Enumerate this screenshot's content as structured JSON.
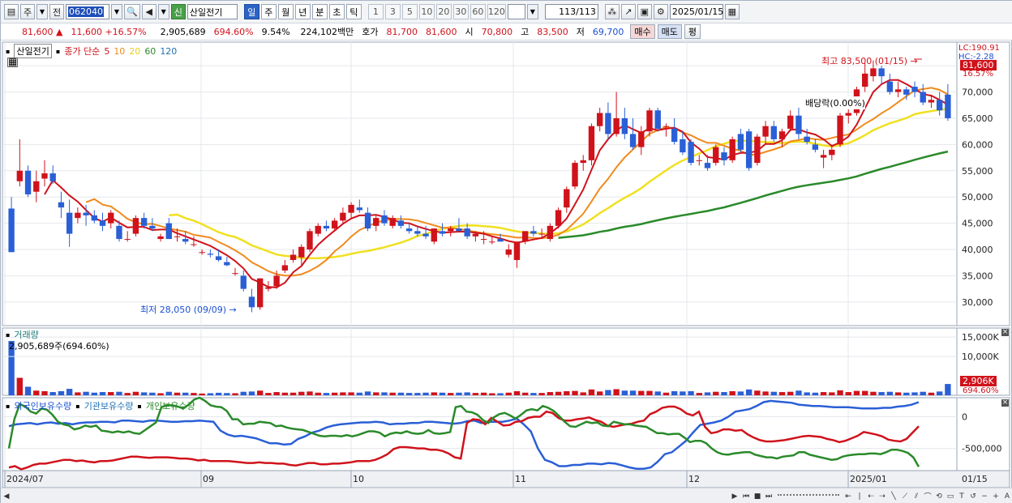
{
  "toolbar": {
    "market_kind": "주",
    "prev_label": "전",
    "code": "062040",
    "badge": "신",
    "stock_name": "산일전기",
    "periods": [
      "일",
      "주",
      "월",
      "년",
      "분",
      "초",
      "틱"
    ],
    "active_period": "일",
    "intervals": [
      "1",
      "3",
      "5",
      "10",
      "20",
      "30",
      "60",
      "120"
    ],
    "count": "113",
    "total": "113",
    "date": "2025/01/15"
  },
  "info": {
    "price": "81,600",
    "arrow": "▲",
    "change": "11,600",
    "change_pct": "+16.57%",
    "volume": "2,905,689",
    "volume_pct": "694.60%",
    "turnover": "9.54%",
    "amount": "224,102백만",
    "quote_label": "호가",
    "ask": "81,700",
    "bid": "81,600",
    "open_label": "시",
    "open": "70,800",
    "high_label": "고",
    "high": "83,500",
    "low_label": "저",
    "low": "69,700",
    "buy": "매수",
    "sell": "매도",
    "eval": "평"
  },
  "price_panel": {
    "legend_name": "산일전기",
    "legend_type": "종가 단순",
    "ma_labels": [
      "5",
      "10",
      "20",
      "60",
      "120"
    ],
    "lc": "LC:190.91",
    "hc": "HC:-2.28",
    "current_tag": "81,600",
    "current_pct": "16.57%",
    "high_note": "최고 83,500 (01/15)",
    "low_note": "최저 28,050 (09/09)",
    "dividend_note": "배당락(0.00%)",
    "y_ticks": [
      "75,000",
      "70,000",
      "65,000",
      "60,000",
      "55,000",
      "50,000",
      "45,000",
      "40,000",
      "35,000",
      "30,000"
    ]
  },
  "volume_panel": {
    "title": "거래량",
    "value": "2,905,689주(694.60%)",
    "y_ticks": [
      "15,000K",
      "10,000K"
    ],
    "current_tag": "2,906K",
    "current_pct": "694.60%"
  },
  "holdings_panel": {
    "series": [
      "외국인보유수량",
      "기관보유수량",
      "개인보유수량"
    ],
    "y_ticks": [
      "0",
      "-500,000"
    ]
  },
  "x_axis": {
    "labels": [
      "2024/07",
      "09",
      "10",
      "11",
      "12",
      "2025/01"
    ],
    "right_label": "01/15"
  },
  "colors": {
    "up": "#d0121b",
    "down": "#2a5fd6",
    "ma5": "#d0121b",
    "ma10": "#f08a1c",
    "ma20": "#f0e020",
    "ma60": "#2a8a2a",
    "foreign": "#2a5fd6",
    "institution": "#d0121b",
    "individual": "#2a8a2a"
  },
  "chart_data": {
    "type": "candlestick",
    "candles": [
      [
        47800,
        50000,
        39500,
        39500
      ],
      [
        53000,
        61000,
        52000,
        55000
      ],
      [
        55000,
        56000,
        50000,
        50500
      ],
      [
        51000,
        55000,
        49000,
        53000
      ],
      [
        53500,
        57000,
        52000,
        54500
      ],
      [
        54500,
        56000,
        52500,
        53000
      ],
      [
        49000,
        51000,
        46000,
        48000
      ],
      [
        47000,
        49500,
        40500,
        43000
      ],
      [
        46000,
        48000,
        45000,
        47000
      ],
      [
        47000,
        48500,
        44500,
        46500
      ],
      [
        46500,
        47500,
        45000,
        45500
      ],
      [
        45500,
        47000,
        43500,
        44500
      ],
      [
        45000,
        47500,
        44000,
        47000
      ],
      [
        44500,
        45500,
        41500,
        42000
      ],
      [
        42000,
        43500,
        41500,
        42000
      ],
      [
        43000,
        46500,
        42500,
        46000
      ],
      [
        46000,
        47000,
        44000,
        44500
      ],
      [
        44500,
        46000,
        43500,
        44000
      ],
      [
        42000,
        43000,
        41500,
        42500
      ],
      [
        45000,
        46000,
        42000,
        42000
      ],
      [
        42500,
        44000,
        41500,
        42500
      ],
      [
        42000,
        43500,
        41000,
        41500
      ],
      [
        41000,
        42500,
        40500,
        41000
      ],
      [
        39500,
        40000,
        39000,
        39500
      ],
      [
        39200,
        40000,
        38500,
        39000
      ],
      [
        38700,
        40000,
        37700,
        38000
      ],
      [
        37600,
        38600,
        36800,
        37000
      ],
      [
        35500,
        36500,
        35000,
        35500
      ],
      [
        35000,
        36000,
        32000,
        32500
      ],
      [
        31000,
        32500,
        28050,
        29000
      ],
      [
        29000,
        34500,
        28500,
        34500
      ],
      [
        32500,
        34000,
        32000,
        32800
      ],
      [
        33000,
        36000,
        32500,
        35000
      ],
      [
        36000,
        38000,
        35500,
        37000
      ],
      [
        38000,
        40000,
        37500,
        39000
      ],
      [
        38500,
        41000,
        37000,
        40500
      ],
      [
        40000,
        44000,
        39500,
        43500
      ],
      [
        43000,
        45000,
        42500,
        44500
      ],
      [
        44500,
        45500,
        43500,
        44000
      ],
      [
        44000,
        46000,
        43500,
        45500
      ],
      [
        45500,
        48000,
        45000,
        47000
      ],
      [
        47000,
        49000,
        46000,
        48500
      ],
      [
        48000,
        49500,
        47000,
        47500
      ],
      [
        47000,
        48000,
        43500,
        44000
      ],
      [
        44500,
        46500,
        43500,
        46000
      ],
      [
        46500,
        47500,
        44500,
        45000
      ],
      [
        44500,
        46500,
        44000,
        46000
      ],
      [
        45500,
        46500,
        44000,
        44500
      ],
      [
        44000,
        45000,
        43000,
        43500
      ],
      [
        43500,
        44500,
        42500,
        43000
      ],
      [
        43000,
        44500,
        42000,
        42500
      ],
      [
        41500,
        44000,
        41000,
        44000
      ],
      [
        43500,
        45000,
        42500,
        43000
      ],
      [
        43500,
        44500,
        42500,
        44000
      ],
      [
        44000,
        46000,
        43500,
        43500
      ],
      [
        44000,
        45000,
        42000,
        42500
      ],
      [
        42500,
        43500,
        41500,
        43000
      ],
      [
        42000,
        43500,
        41000,
        42000
      ],
      [
        41500,
        42500,
        41000,
        41500
      ],
      [
        42000,
        43000,
        41500,
        41500
      ],
      [
        39000,
        41000,
        38500,
        40000
      ],
      [
        38000,
        41500,
        36500,
        41500
      ],
      [
        41500,
        43500,
        41000,
        43500
      ],
      [
        43500,
        44500,
        42500,
        43000
      ],
      [
        43000,
        44000,
        42000,
        43000
      ],
      [
        42000,
        45000,
        41500,
        44500
      ],
      [
        44500,
        48000,
        44000,
        47500
      ],
      [
        48000,
        52000,
        47000,
        51500
      ],
      [
        52000,
        57000,
        51500,
        56500
      ],
      [
        56500,
        58000,
        55000,
        57000
      ],
      [
        57000,
        64000,
        56000,
        63500
      ],
      [
        63500,
        67000,
        62500,
        66000
      ],
      [
        66000,
        68000,
        61000,
        62000
      ],
      [
        62000,
        70000,
        61500,
        65000
      ],
      [
        65000,
        67000,
        61000,
        62000
      ],
      [
        62000,
        65000,
        59000,
        59500
      ],
      [
        59500,
        63500,
        58000,
        62500
      ],
      [
        62500,
        67000,
        61500,
        66500
      ],
      [
        66500,
        67000,
        62500,
        63000
      ],
      [
        63500,
        64000,
        61500,
        63500
      ],
      [
        63000,
        65000,
        60000,
        60500
      ],
      [
        61000,
        62500,
        58000,
        58500
      ],
      [
        60500,
        61000,
        56000,
        56500
      ],
      [
        57000,
        58000,
        56000,
        57000
      ],
      [
        56500,
        58000,
        55000,
        55500
      ],
      [
        56500,
        60000,
        56000,
        59500
      ],
      [
        58500,
        59500,
        56000,
        57000
      ],
      [
        57000,
        61500,
        56500,
        61000
      ],
      [
        62000,
        63000,
        58500,
        59000
      ],
      [
        62500,
        63000,
        55000,
        55500
      ],
      [
        56500,
        62000,
        56000,
        61500
      ],
      [
        61500,
        64500,
        60000,
        63500
      ],
      [
        63500,
        64500,
        60500,
        61000
      ],
      [
        61000,
        63000,
        59500,
        62500
      ],
      [
        63000,
        66500,
        62500,
        65500
      ],
      [
        65500,
        67000,
        61000,
        62000
      ],
      [
        61500,
        63000,
        60000,
        60500
      ],
      [
        60000,
        61000,
        58500,
        59000
      ],
      [
        57500,
        59000,
        55500,
        58000
      ],
      [
        58000,
        60000,
        57000,
        59000
      ],
      [
        60000,
        66000,
        59500,
        65500
      ],
      [
        65500,
        67500,
        64000,
        66000
      ],
      [
        66000,
        71000,
        65500,
        70500
      ],
      [
        71000,
        75500,
        70000,
        73500
      ],
      [
        73000,
        76000,
        72000,
        74500
      ],
      [
        74500,
        75000,
        71500,
        73000
      ],
      [
        72000,
        73500,
        69500,
        70000
      ],
      [
        70000,
        72000,
        69000,
        70500
      ],
      [
        70500,
        71000,
        68500,
        69500
      ],
      [
        71000,
        72000,
        69000,
        70000
      ],
      [
        70000,
        71500,
        67500,
        68000
      ],
      [
        68000,
        69500,
        67000,
        68500
      ],
      [
        68500,
        70000,
        65500,
        66500
      ],
      [
        69500,
        71500,
        64500,
        65000
      ]
    ],
    "ma_note": "5/10/20/60 day simple moving averages of close",
    "volume_note": "relative daily volume",
    "y_range": [
      25500,
      79500
    ],
    "volume_max": 16500,
    "holdings_y_range": [
      -850000,
      300000
    ],
    "series": [
      {
        "name": "외국인보유수량",
        "values": [
          -150000,
          -120000,
          -110000,
          -100000,
          -120000,
          -100000,
          -90000,
          -110000,
          -100000,
          -120000,
          -100000,
          -90000,
          -90000,
          -80000,
          -80000,
          -90000,
          -60000,
          -60000,
          -70000,
          -80000,
          -60000,
          -60000,
          -70000,
          -80000,
          -80000,
          -70000,
          -70000,
          -60000,
          -70000,
          -80000,
          -220000,
          -280000,
          -310000,
          -300000,
          -320000,
          -340000,
          -380000,
          -420000,
          -420000,
          -440000,
          -430000,
          -350000,
          -310000,
          -250000,
          -220000,
          -170000,
          -140000,
          -120000,
          -110000,
          -100000,
          -90000,
          -90000,
          -80000,
          -90000,
          -120000,
          -110000,
          -110000,
          -100000,
          -100000,
          -80000,
          -80000,
          -90000,
          -100000,
          -110000,
          -100000,
          -70000,
          -60000,
          -100000,
          -80000,
          -80000,
          -80000,
          -60000,
          -30000,
          -120000,
          -230000,
          -500000,
          -680000,
          -720000,
          -780000,
          -780000,
          -760000,
          -760000,
          -740000,
          -740000,
          -750000,
          -730000,
          -740000,
          -770000,
          -800000,
          -820000,
          -820000,
          -800000,
          -710000,
          -590000,
          -560000,
          -470000,
          -380000,
          -250000,
          -130000,
          -110000,
          -90000,
          -60000,
          0,
          80000,
          100000,
          120000,
          170000,
          230000,
          250000,
          240000,
          230000,
          220000,
          190000,
          180000,
          170000,
          170000,
          160000,
          150000,
          150000,
          150000,
          140000,
          130000,
          130000,
          130000,
          140000,
          140000,
          160000,
          170000,
          190000,
          230000
        ]
      },
      {
        "name": "기관보유수량",
        "values": [
          -800000,
          -780000,
          -830000,
          -800000,
          -760000,
          -740000,
          -740000,
          -720000,
          -700000,
          -680000,
          -680000,
          -700000,
          -690000,
          -710000,
          -720000,
          -700000,
          -700000,
          -690000,
          -670000,
          -650000,
          -630000,
          -630000,
          -640000,
          -650000,
          -640000,
          -640000,
          -640000,
          -650000,
          -660000,
          -660000,
          -670000,
          -690000,
          -680000,
          -700000,
          -700000,
          -700000,
          -700000,
          -710000,
          -720000,
          -730000,
          -730000,
          -720000,
          -730000,
          -730000,
          -740000,
          -740000,
          -760000,
          -770000,
          -750000,
          -730000,
          -730000,
          -750000,
          -750000,
          -740000,
          -740000,
          -730000,
          -720000,
          -700000,
          -700000,
          -700000,
          -680000,
          -640000,
          -590000,
          -510000,
          -480000,
          -480000,
          -490000,
          -500000,
          -500000,
          -520000,
          -520000,
          -540000,
          -580000,
          -640000,
          -660000,
          -100000,
          -40000,
          -50000,
          -120000,
          -20000,
          -80000,
          -140000,
          -130000,
          -80000,
          -70000,
          -20000,
          0,
          0,
          80000,
          60000,
          -20000,
          -60000,
          -60000,
          -40000,
          -30000,
          -10000,
          -50000,
          -80000,
          -140000,
          -160000,
          -140000,
          -120000,
          -110000,
          -80000,
          -60000,
          40000,
          80000,
          140000,
          160000,
          160000,
          120000,
          50000,
          20000,
          80000,
          -160000,
          -260000,
          -240000,
          -200000,
          -200000,
          -220000,
          -210000,
          -280000,
          -330000,
          -370000,
          -390000,
          -390000,
          -380000,
          -370000,
          -350000,
          -330000,
          -310000,
          -300000,
          -310000,
          -320000,
          -350000,
          -370000,
          -400000,
          -380000,
          -340000,
          -300000,
          -240000,
          -260000,
          -280000,
          -310000,
          -360000,
          -380000,
          -390000,
          -350000,
          -250000,
          -150000
        ]
      },
      {
        "name": "개인보유수량",
        "values": [
          -500000,
          -40000,
          200000,
          160000,
          80000,
          50000,
          130000,
          110000,
          30000,
          -80000,
          -120000,
          -140000,
          -200000,
          -180000,
          -140000,
          -160000,
          -140000,
          -220000,
          -230000,
          -250000,
          -230000,
          -250000,
          -230000,
          -260000,
          -270000,
          -210000,
          -150000,
          -90000,
          150000,
          180000,
          180000,
          160000,
          130000,
          190000,
          270000,
          300000,
          250000,
          180000,
          160000,
          150000,
          90000,
          -40000,
          -40000,
          -120000,
          -110000,
          -110000,
          -80000,
          -90000,
          -100000,
          -150000,
          -140000,
          -170000,
          -190000,
          -200000,
          -210000,
          -240000,
          -270000,
          -300000,
          -310000,
          -300000,
          -300000,
          -310000,
          -290000,
          -310000,
          -290000,
          -260000,
          -230000,
          -230000,
          -250000,
          -310000,
          -270000,
          -250000,
          -260000,
          -230000,
          -260000,
          -270000,
          -260000,
          -210000,
          -260000,
          -270000,
          -260000,
          -240000,
          150000,
          170000,
          80000,
          70000,
          30000,
          -50000,
          -100000,
          -10000,
          40000,
          60000,
          20000,
          -30000,
          30000,
          100000,
          120000,
          100000,
          170000,
          140000,
          90000,
          10000,
          -80000,
          -150000,
          -160000,
          -120000,
          -80000,
          -100000,
          -90000,
          -140000,
          -150000,
          -80000,
          -100000,
          -120000,
          -120000,
          -140000,
          -150000,
          -160000,
          -210000,
          -260000,
          -260000,
          -280000,
          -270000,
          -270000,
          -330000,
          -400000,
          -380000,
          -380000,
          -420000,
          -500000,
          -560000,
          -590000,
          -600000,
          -580000,
          -570000,
          -560000,
          -560000,
          -600000,
          -620000,
          -640000,
          -640000,
          -660000,
          -630000,
          -620000,
          -610000,
          -560000,
          -560000,
          -600000,
          -620000,
          -640000,
          -660000,
          -680000,
          -670000,
          -630000,
          -610000,
          -600000,
          -590000,
          -590000,
          -580000,
          -580000,
          -590000,
          -560000,
          -520000,
          -520000,
          -540000,
          -570000,
          -640000,
          -790000
        ]
      }
    ]
  }
}
